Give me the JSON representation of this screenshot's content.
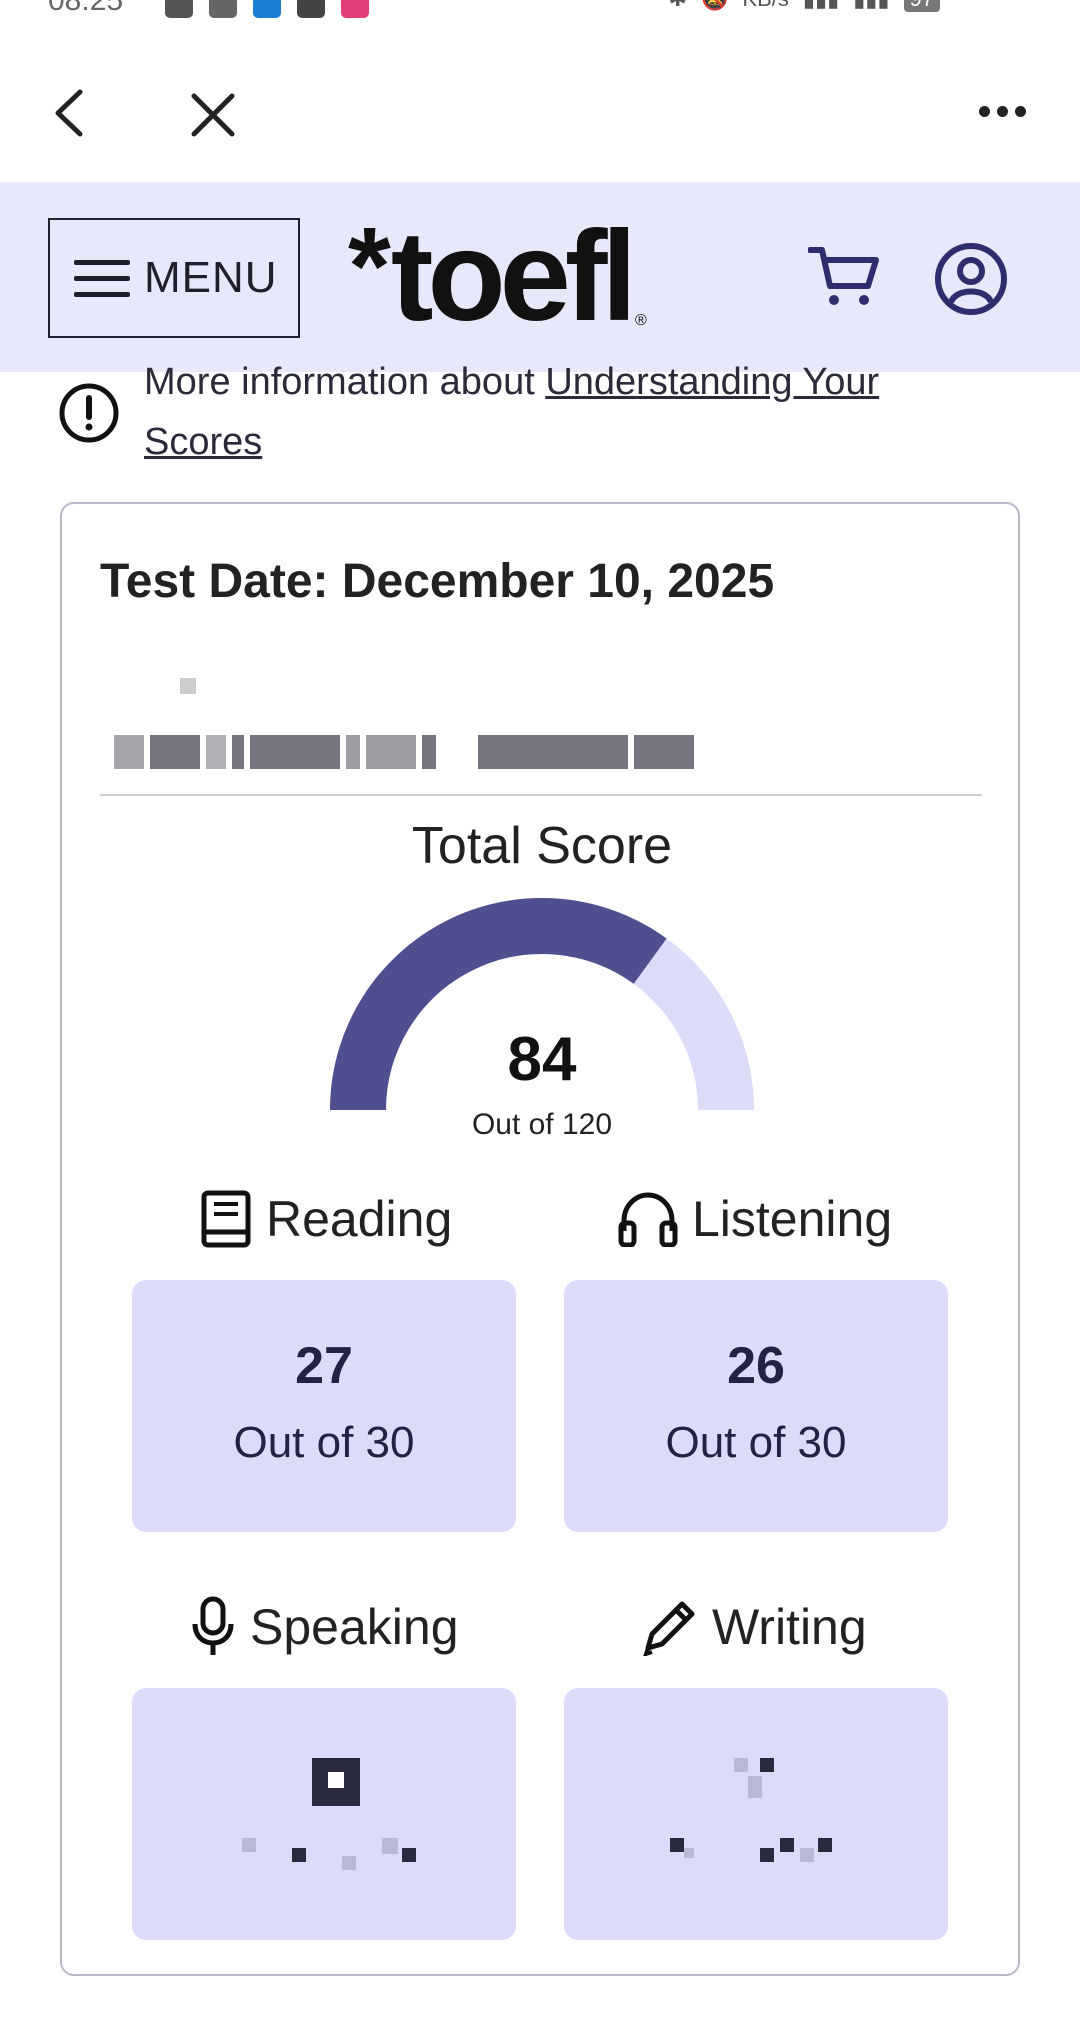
{
  "status_bar": {
    "time": "08:25",
    "speed": "KB/s",
    "battery": "97"
  },
  "browser": {
    "back": "back",
    "close": "close",
    "more": "more"
  },
  "header": {
    "menu_label": "MENU",
    "logo_text": "toefl",
    "logo_mark": "*",
    "logo_reg": "®"
  },
  "info": {
    "text": "More information about ",
    "link": "Understanding Your Scores"
  },
  "card": {
    "test_date": "Test Date: December 10, 2025",
    "total": {
      "label": "Total Score",
      "value": "84",
      "max": "Out of 120",
      "fraction": 0.7
    },
    "sections": [
      {
        "name": "Reading",
        "icon": "book-icon",
        "score": "27",
        "out": "Out of 30"
      },
      {
        "name": "Listening",
        "icon": "headphones-icon",
        "score": "26",
        "out": "Out of 30"
      },
      {
        "name": "Speaking",
        "icon": "microphone-icon",
        "score": "",
        "out": ""
      },
      {
        "name": "Writing",
        "icon": "pencil-icon",
        "score": "",
        "out": ""
      }
    ]
  },
  "colors": {
    "accent": "#4f4f8f",
    "gauge_track": "#dcdcf8",
    "header_bg": "#e8e8fb",
    "box_bg": "#dcdcfa"
  }
}
